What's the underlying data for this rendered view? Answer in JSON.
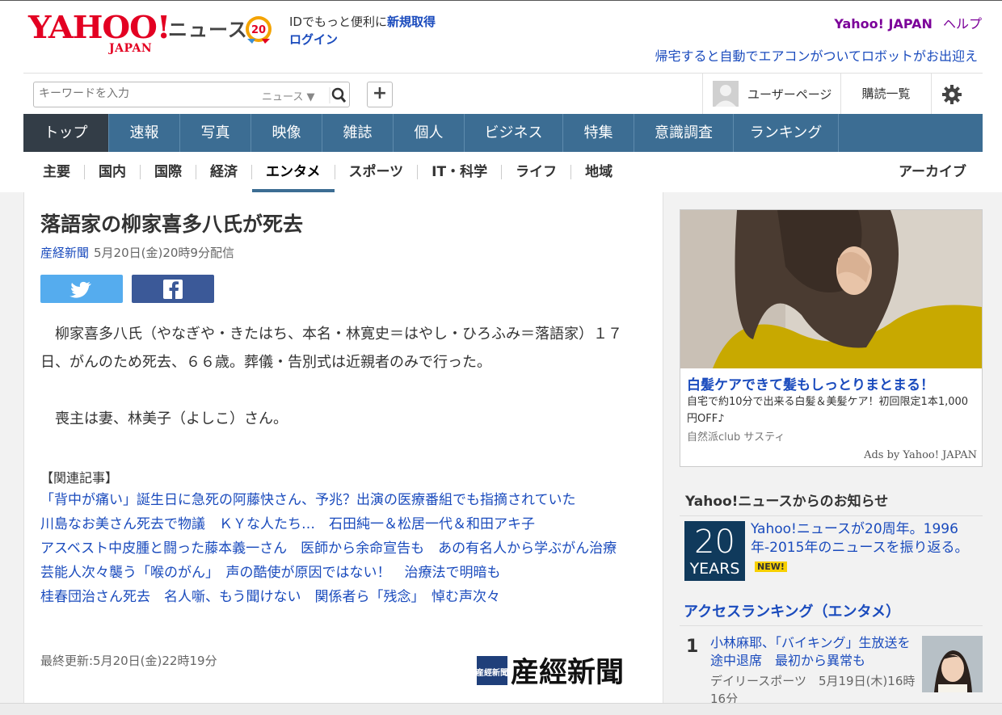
{
  "header": {
    "logo_main": "YAHOO!",
    "logo_sub": "JAPAN",
    "section": "ニュース",
    "id_prompt": "IDでもっと便利に",
    "register_link": "新規取得",
    "login_link": "ログイン",
    "yahoo_japan_link": "Yahoo! JAPAN",
    "help_link": "ヘルプ",
    "promo": "帰宅すると自動でエアコンがついてロボットがお出迎え"
  },
  "search": {
    "placeholder": "キーワードを入力",
    "scope": "ニュース ▼",
    "add_label": "+"
  },
  "user": {
    "page_label": "ユーザーページ",
    "subscriptions_label": "購読一覧"
  },
  "main_nav": [
    {
      "label": "トップ"
    },
    {
      "label": "速報"
    },
    {
      "label": "写真"
    },
    {
      "label": "映像"
    },
    {
      "label": "雑誌"
    },
    {
      "label": "個人"
    },
    {
      "label": "ビジネス"
    },
    {
      "label": "特集"
    },
    {
      "label": "意識調査"
    },
    {
      "label": "ランキング"
    }
  ],
  "sub_nav": [
    {
      "label": "主要"
    },
    {
      "label": "国内"
    },
    {
      "label": "国際"
    },
    {
      "label": "経済"
    },
    {
      "label": "エンタメ"
    },
    {
      "label": "スポーツ"
    },
    {
      "label": "IT・科学"
    },
    {
      "label": "ライフ"
    },
    {
      "label": "地域"
    }
  ],
  "archive_label": "アーカイブ",
  "article": {
    "title": "落語家の柳家喜多八氏が死去",
    "source": "産経新聞",
    "date": "5月20日(金)20時9分配信",
    "paragraph1": "　柳家喜多八氏（やなぎや・きたはち、本名・林寛史＝はやし・ひろふみ＝落語家）１７日、がんのため死去、６６歳。葬儀・告別式は近親者のみで行った。",
    "paragraph2": "　喪主は妻、林美子（よしこ）さん。",
    "related_heading": "【関連記事】",
    "related": [
      "「背中が痛い」誕生日に急死の阿藤快さん、予兆？出演の医療番組でも指摘されていた",
      "川島なお美さん死去で物議　ＫＹな人たち…　石田純一＆松居一代＆和田アキ子",
      "アスベスト中皮腫と闘った藤本義一さん　医師から余命宣告も　あの有名人から学ぶがん治療",
      "芸能人次々襲う「喉のがん」　声の酷使が原因ではない！　治療法で明暗も",
      "桂春団治さん死去　名人噺、もう聞けない　関係者ら「残念」　悼む声次々"
    ],
    "updated": "最終更新:5月20日(金)22時19分",
    "publisher_logo_main": "産經新聞",
    "publisher_logo_small": "産經新聞"
  },
  "ad": {
    "title": "白髪ケアできて髪もしっとりまとまる！",
    "description": "自宅で約10分で出来る白髪＆美髪ケア！初回限定1本1,000円OFF♪",
    "advertiser": "自然派club サスティ",
    "by": "Ads by Yahoo! JAPAN"
  },
  "notice": {
    "heading": "Yahoo!ニュースからのお知らせ",
    "badge_number": "20",
    "badge_word": "YEARS",
    "text": "Yahoo!ニュースが20周年。1996年-2015年のニュースを振り返る。",
    "new_label": "NEW!"
  },
  "ranking": {
    "heading": "アクセスランキング（エンタメ）",
    "items": [
      {
        "rank": "1",
        "title": "小林麻耶、「バイキング」生放送を途中退席　最初から異常も",
        "meta": "デイリースポーツ　5月19日(木)16時16分"
      }
    ]
  },
  "colors": {
    "brand_red": "#e30022",
    "nav_blue": "#3c6d93",
    "nav_active": "#333d47",
    "link": "#1a4bbd",
    "twitter": "#55acee",
    "facebook": "#3b5998"
  }
}
